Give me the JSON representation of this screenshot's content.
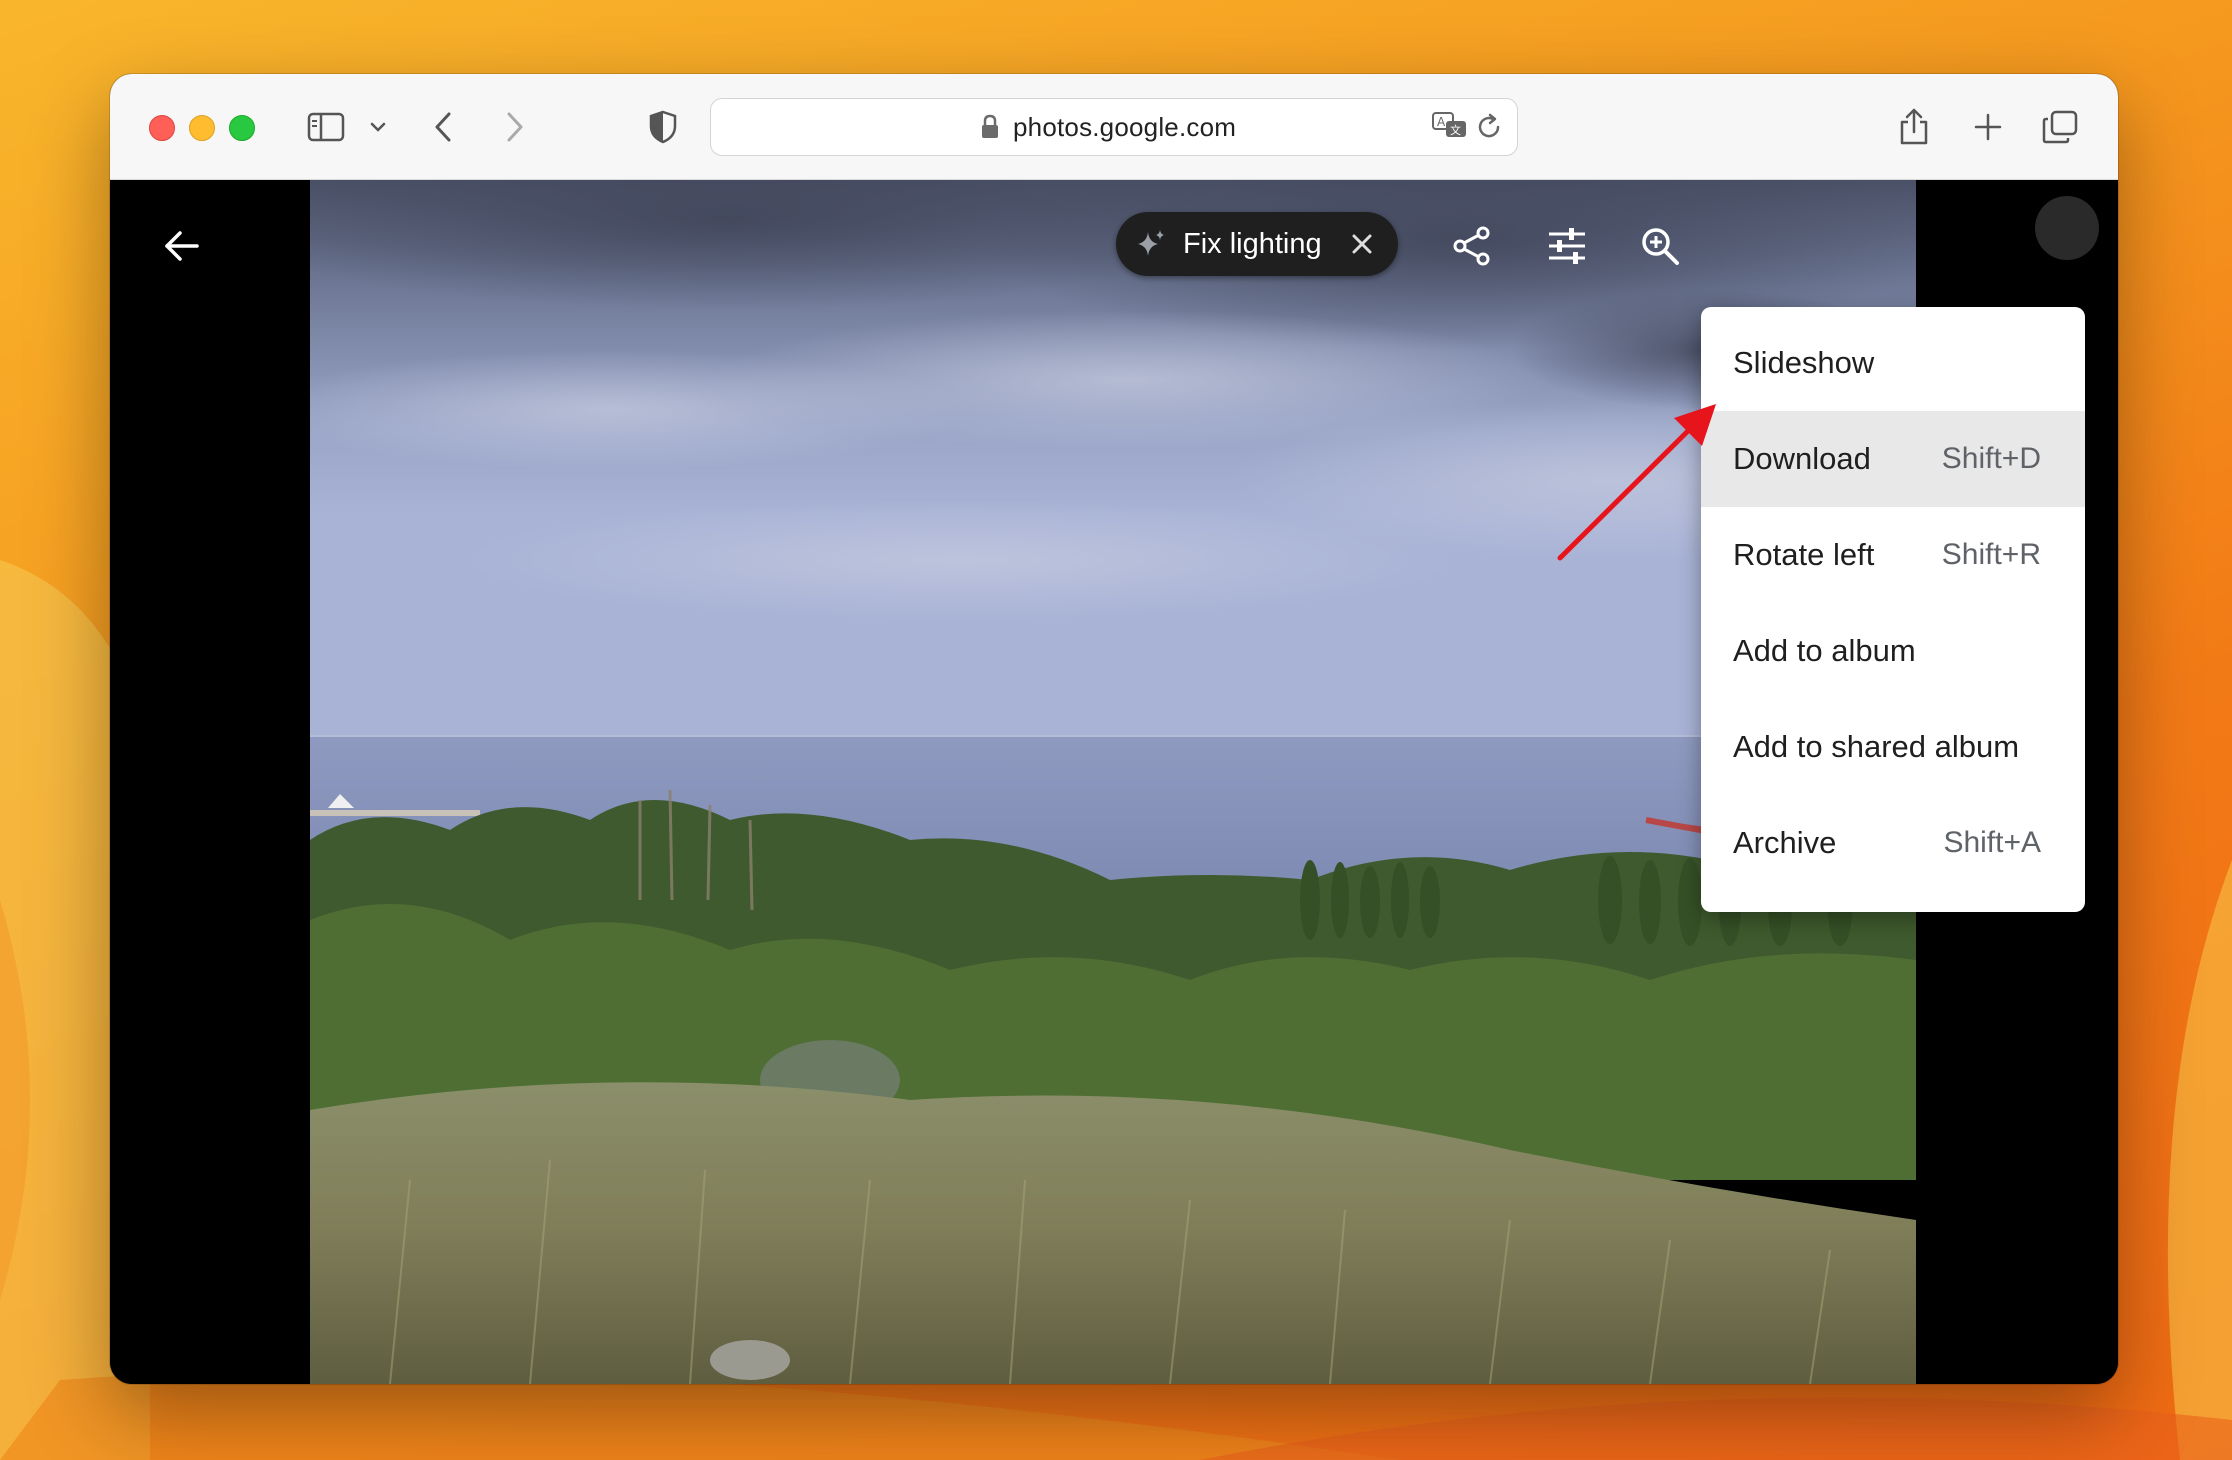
{
  "browser": {
    "url": "photos.google.com"
  },
  "viewer": {
    "chip_label": "Fix lighting"
  },
  "menu": {
    "items": [
      {
        "label": "Slideshow",
        "shortcut": ""
      },
      {
        "label": "Download",
        "shortcut": "Shift+D"
      },
      {
        "label": "Rotate left",
        "shortcut": "Shift+R"
      },
      {
        "label": "Add to album",
        "shortcut": ""
      },
      {
        "label": "Add to shared album",
        "shortcut": ""
      },
      {
        "label": "Archive",
        "shortcut": "Shift+A"
      }
    ]
  },
  "colors": {
    "annotation_arrow": "#e8141c",
    "menu_hover": "#e8e8e8",
    "chip_bg": "#1f1f1f"
  },
  "icons": {
    "toolbar": [
      "sidebar-icon",
      "chevron-down-icon",
      "back-icon",
      "forward-icon",
      "shield-icon",
      "lock-icon",
      "translate-icon",
      "reload-icon",
      "share-icon",
      "new-tab-icon",
      "tab-overview-icon"
    ],
    "viewer": [
      "arrow-back-icon",
      "sparkle-icon",
      "close-icon",
      "share-icon",
      "tune-icon",
      "zoom-in-icon"
    ]
  }
}
